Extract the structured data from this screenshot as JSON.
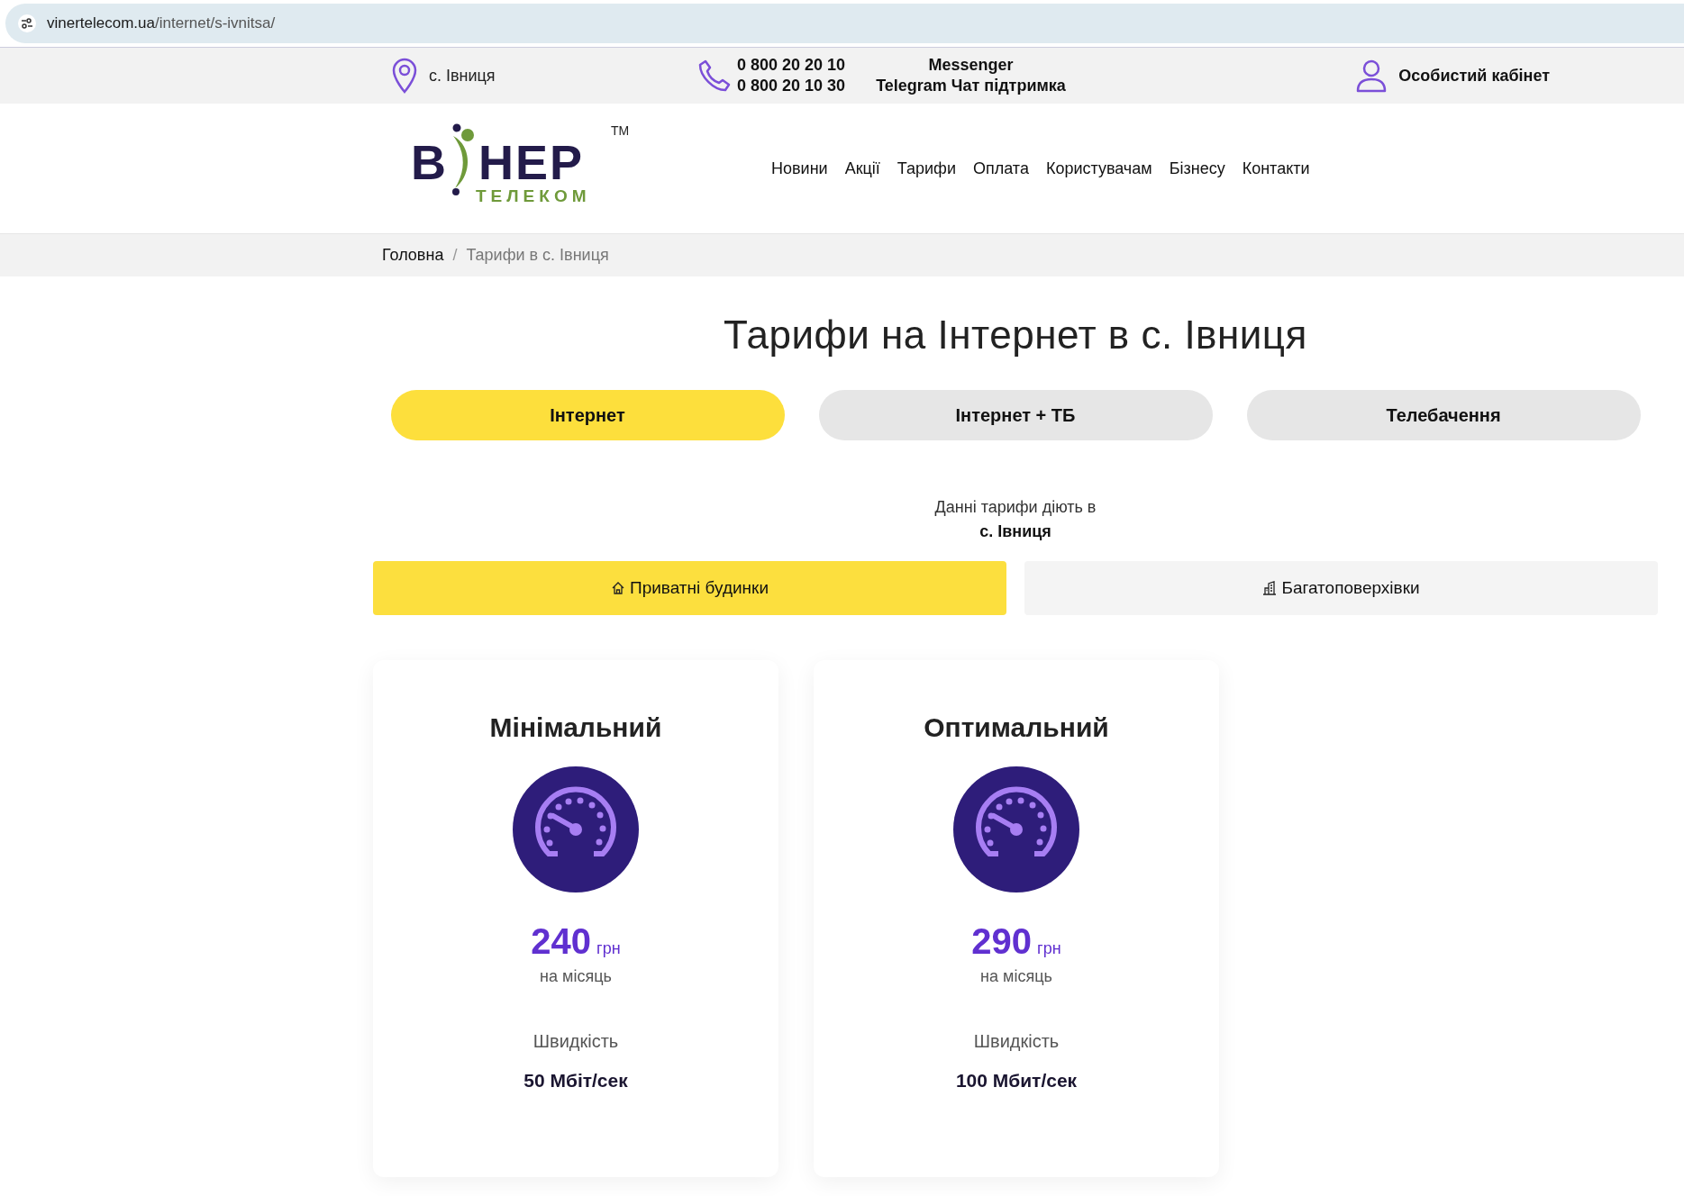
{
  "browser": {
    "url_host": "vinertelecom.ua",
    "url_path": "/internet/s-ivnitsa/"
  },
  "topbar": {
    "location": "с. Івниця",
    "phones": [
      "0 800 20 20 10",
      "0 800 20 10 30"
    ],
    "messengers": [
      "Messenger",
      "Telegram Чат підтримка"
    ],
    "account": "Особистий кабінет"
  },
  "logo": {
    "left": "В",
    "right": "НЕР",
    "sub": "ТЕЛЕКОМ",
    "mark": "TM"
  },
  "nav": [
    "Новини",
    "Акції",
    "Тарифи",
    "Оплата",
    "Користувачам",
    "Бізнесу",
    "Контакти"
  ],
  "breadcrumb_separator": "/",
  "breadcrumb": [
    {
      "label": "Головна",
      "current": false
    },
    {
      "label": "Тарифи в с. Івниця",
      "current": true
    }
  ],
  "title": "Тарифи на Інтернет в с. Івниця",
  "tabs": [
    {
      "label": "Інтернет",
      "selected": true
    },
    {
      "label": "Інтернет + ТБ",
      "selected": false
    },
    {
      "label": "Телебачення",
      "selected": false
    }
  ],
  "notice": {
    "text": "Данні тарифи діють в",
    "place": "с. Івниця"
  },
  "subtabs": [
    {
      "label": "Приватні будинки",
      "kind": "house",
      "selected": true
    },
    {
      "label": "Багатоповерхівки",
      "kind": "building",
      "selected": false
    }
  ],
  "plans": [
    {
      "name": "Мінімальний",
      "price": "240",
      "currency": "грн",
      "period": "на місяць",
      "speed_label": "Швидкість",
      "speed": "50 Мбіт/сек"
    },
    {
      "name": "Оптимальний",
      "price": "290",
      "currency": "грн",
      "period": "на місяць",
      "speed_label": "Швидкість",
      "speed": "100 Мбит/сек"
    }
  ]
}
